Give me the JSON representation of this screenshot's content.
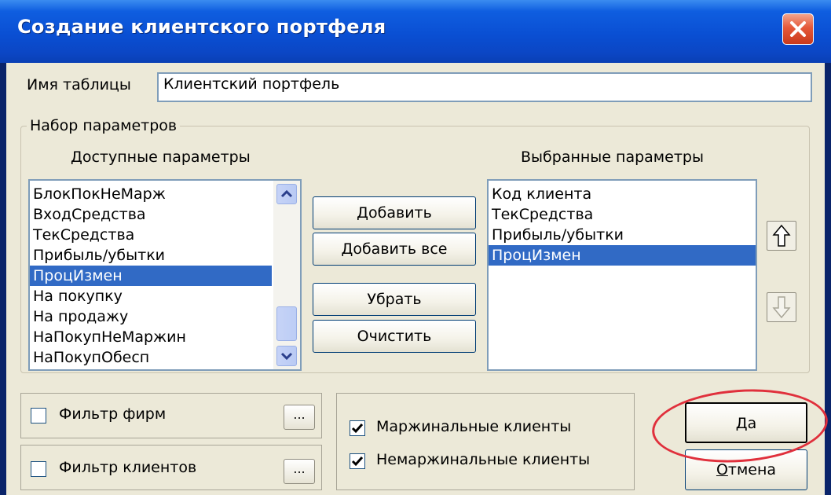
{
  "window": {
    "title": "Создание клиентского портфеля"
  },
  "table_name": {
    "label": "Имя таблицы",
    "value": "Клиентский портфель"
  },
  "params_group": {
    "caption": "Набор параметров",
    "available_header": "Доступные параметры",
    "selected_header": "Выбранные параметры",
    "available_items": [
      "БлокПокНеМарж",
      "ВходСредства",
      "ТекСредства",
      "Прибыль/убытки",
      "ПроцИзмен",
      "На покупку",
      "На продажу",
      "НаПокупНеМаржин",
      "НаПокупОбесп"
    ],
    "available_selected_index": 4,
    "selected_items": [
      "Код клиента",
      "ТекСредства",
      "Прибыль/убытки",
      "ПроцИзмен"
    ],
    "selected_selected_index": 3,
    "buttons": {
      "add": "Добавить",
      "add_all": "Добавить все",
      "remove": "Убрать",
      "clear": "Очистить"
    },
    "icons": {
      "up": "arrow-up-icon",
      "down": "arrow-down-icon"
    }
  },
  "filters": {
    "firm_filter": {
      "label": "Фильтр фирм",
      "checked": false,
      "button": "..."
    },
    "client_filter": {
      "label": "Фильтр клиентов",
      "checked": false,
      "button": "..."
    }
  },
  "client_types": {
    "margin": {
      "label": "Маржинальные клиенты",
      "checked": true
    },
    "nonmargin": {
      "label": "Немаржинальные клиенты",
      "checked": true
    }
  },
  "dialog_buttons": {
    "ok_accel": "Д",
    "ok_rest": "а",
    "cancel_accel": "О",
    "cancel_rest": "тмена"
  },
  "colors": {
    "title_bar": "#0a4fd3",
    "selection": "#316ac5",
    "highlight_ring": "#e0303c",
    "dialog_bg": "#ece9d8"
  }
}
